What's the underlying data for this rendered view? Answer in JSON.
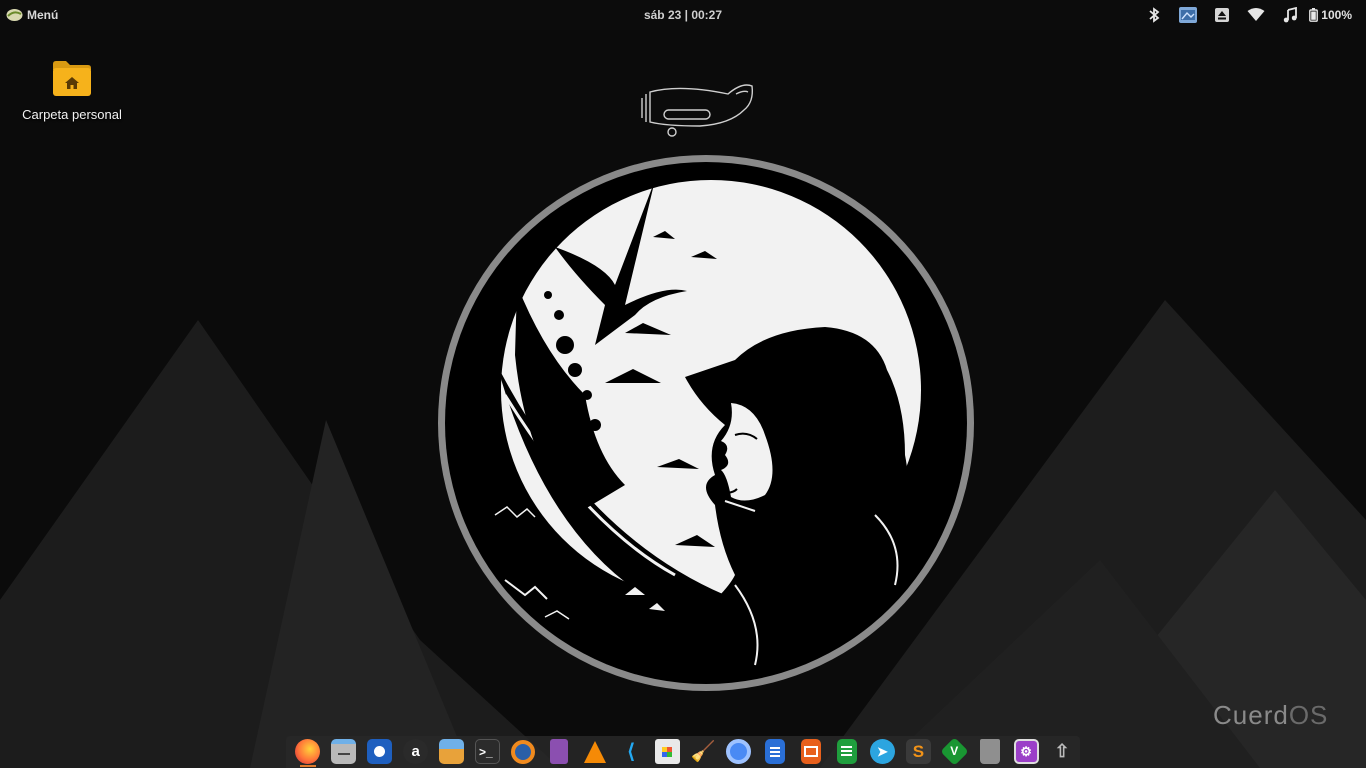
{
  "topbar": {
    "menu_label": "Menú",
    "clock": "sáb 23 | 00:27",
    "tray": {
      "icons": [
        "bluetooth-icon",
        "screenshot-app-icon",
        "eject-icon",
        "wifi-icon",
        "music-icon",
        "battery-icon"
      ],
      "battery_text": "100%"
    }
  },
  "desktop": {
    "icons": [
      {
        "label": "Carpeta personal",
        "icon": "home-folder-icon"
      }
    ],
    "brand": {
      "part1": "Cuerd",
      "part2": "OS"
    }
  },
  "dock": {
    "apps": [
      {
        "name": "firefox",
        "color": "#ff7139"
      },
      {
        "name": "file-manager",
        "color": "#9a9a9a"
      },
      {
        "name": "video-player",
        "color": "#1e5fbf"
      },
      {
        "name": "amazon",
        "color": "#3a3a3a"
      },
      {
        "name": "image-viewer",
        "color": "#e8a23a"
      },
      {
        "name": "terminal",
        "color": "#2b2b2b"
      },
      {
        "name": "blender",
        "color": "#f08a1e"
      },
      {
        "name": "database",
        "color": "#8b4fb0"
      },
      {
        "name": "vlc",
        "color": "#f58a06"
      },
      {
        "name": "vscode",
        "color": "#23a9f2"
      },
      {
        "name": "software-store",
        "color": "#e9e9e9"
      },
      {
        "name": "cleaner",
        "color": "#f0b41f"
      },
      {
        "name": "chromium",
        "color": "#4a8af4"
      },
      {
        "name": "writer",
        "color": "#2a6fd6"
      },
      {
        "name": "impress",
        "color": "#e8601c"
      },
      {
        "name": "calc",
        "color": "#1f9e3d"
      },
      {
        "name": "telegram",
        "color": "#2ca5e0"
      },
      {
        "name": "sublime-text",
        "color": "#f29318"
      },
      {
        "name": "vim",
        "color": "#199632"
      },
      {
        "name": "trash",
        "color": "#8f8f8f"
      },
      {
        "name": "remote-desktop",
        "color": "#9b3fc8"
      },
      {
        "name": "upload-tool",
        "color": "#5a5a5a"
      }
    ]
  }
}
